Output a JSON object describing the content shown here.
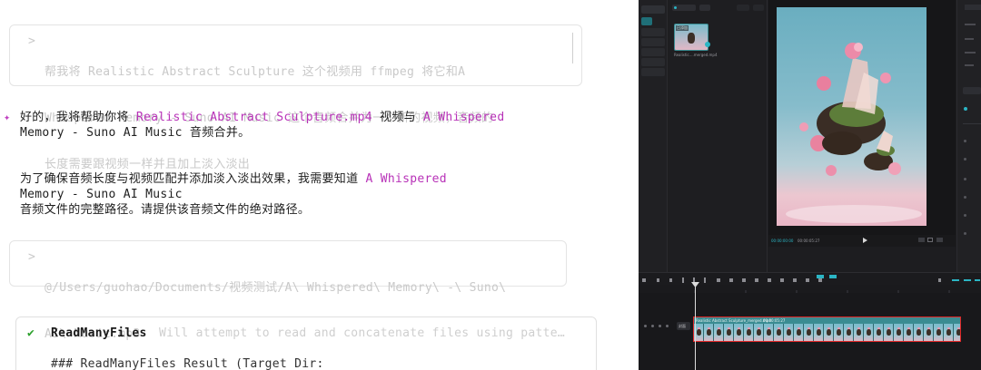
{
  "chat": {
    "prompt1": {
      "marker": ">",
      "lines": [
        "帮我将 Realistic Abstract Sculpture 这个视频用 ffmpeg 将它和A",
        "Whispered Memory - Suno AI Music 这个音频合并为一个新的视频，音频的",
        "长度需要跟视频一样并且加上淡入淡出"
      ]
    },
    "response": {
      "icon": "✦",
      "p1_a": "好的，我将帮助你将 ",
      "p1_file": "Realistic Abstract Sculpture.mp4",
      "p1_b": " 视频与 ",
      "p1_audio": "A Whispered",
      "p1_line2": "Memory - Suno AI Music 音频合并。",
      "p2_a": "为了确保音频长度与视频匹配并添加淡入淡出效果，我需要知道 ",
      "p2_audio": "A Whispered",
      "p2_line2": "Memory - Suno AI Music",
      "p2_line3": "音频文件的完整路径。请提供该音频文件的绝对路径。"
    },
    "prompt2": {
      "marker": ">",
      "lines": [
        "@/Users/guohao/Documents/视频测试/A\\ Whispered\\ Memory\\ -\\ Suno\\",
        "AI\\ Music.mp3"
      ]
    },
    "tool": {
      "check": "✔",
      "name": "ReadManyFiles",
      "desc": "Will attempt to read and concatenate files using patte…",
      "result": "### ReadManyFiles Result (Target Dir:"
    }
  },
  "editor": {
    "clip_title": "Realistic Abstract Sculpture_merged.mp4",
    "clip_time": "00:00:05:27",
    "time_current": "00:00:00:00",
    "time_total": "00:00:05:27",
    "track_label": "封面",
    "media_thumb_label": "Realistic....merged.mp4",
    "media_thumb_badge": "已添加",
    "colors": {
      "accent": "#2bb5c4",
      "clip": "#3a8c92",
      "selection": "#e02828",
      "highlight_text": "#b832b8"
    }
  }
}
